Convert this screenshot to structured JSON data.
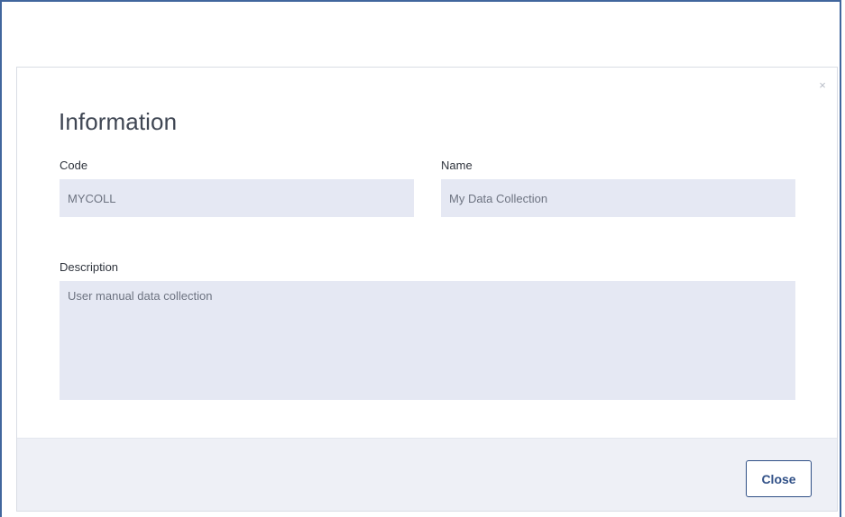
{
  "dialog": {
    "title": "Information",
    "close_icon_glyph": "×",
    "close_icon_name": "close-icon"
  },
  "fields": {
    "code": {
      "label": "Code",
      "value": "MYCOLL"
    },
    "name": {
      "label": "Name",
      "value": "My Data Collection"
    },
    "description": {
      "label": "Description",
      "value": "User manual data collection"
    }
  },
  "footer": {
    "close_label": "Close"
  },
  "colors": {
    "frame_border": "#41669d",
    "field_background": "#e5e8f3",
    "footer_background": "#eef0f6",
    "primary_button": "#2f4f86"
  }
}
